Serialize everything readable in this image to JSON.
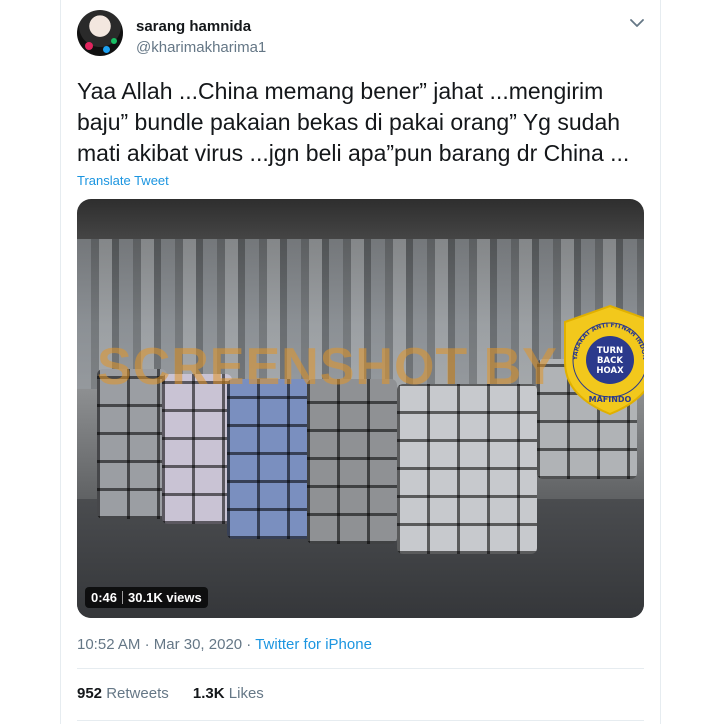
{
  "user": {
    "name": "sarang hamnida",
    "handle": "@kharimakharima1"
  },
  "tweet": {
    "text": "Yaa Allah ...China memang bener” jahat ...mengirim baju” bundle pakaian bekas di pakai orang” Yg sudah mati akibat virus ...jgn beli apa”pun barang dr China ...",
    "translate_label": "Translate Tweet"
  },
  "media": {
    "watermark": "SCREENSHOT BY",
    "duration": "0:46",
    "views": "30.1K views",
    "badge": {
      "ring_text": "MASYARAKAT ANTI FITNAH INDONESIA",
      "center_lines": [
        "TURN",
        "BACK",
        "HOAX"
      ],
      "bottom_text": "MAFINDO"
    }
  },
  "meta": {
    "time": "10:52 AM",
    "date": "Mar 30, 2020",
    "separator": "·",
    "source": "Twitter for iPhone"
  },
  "stats": {
    "retweets_count": "952",
    "retweets_label": "Retweets",
    "likes_count": "1.3K",
    "likes_label": "Likes"
  },
  "colors": {
    "link": "#1b95e0",
    "secondary_text": "#657786",
    "badge_yellow": "#f2c81c",
    "badge_navy": "#2b3a8c"
  }
}
